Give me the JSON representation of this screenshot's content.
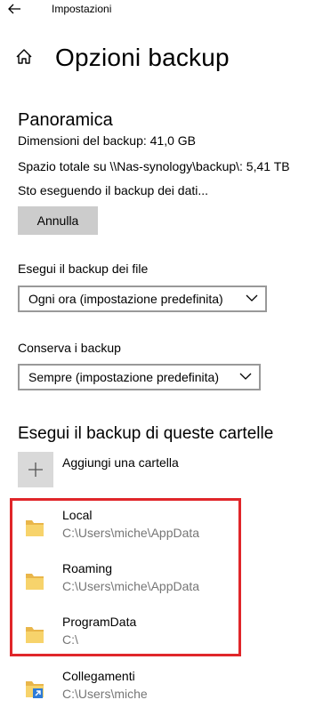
{
  "window": {
    "title": "Impostazioni"
  },
  "header": {
    "page_title": "Opzioni backup"
  },
  "overview": {
    "heading": "Panoramica",
    "size_text": "Dimensioni del backup: 41,0 GB",
    "space_text": "Spazio totale su \\\\Nas-synology\\backup\\: 5,41 TB",
    "status_text": "Sto eseguendo il backup dei dati...",
    "cancel_label": "Annulla"
  },
  "frequency": {
    "label": "Esegui il backup dei file",
    "selected": "Ogni ora (impostazione predefinita)"
  },
  "retention": {
    "label": "Conserva i backup",
    "selected": "Sempre (impostazione predefinita)"
  },
  "folders": {
    "heading": "Esegui il backup di queste cartelle",
    "add_label": "Aggiungi una cartella",
    "items": [
      {
        "name": "Local",
        "path": "C:\\Users\\miche\\AppData"
      },
      {
        "name": "Roaming",
        "path": "C:\\Users\\miche\\AppData"
      },
      {
        "name": "ProgramData",
        "path": "C:\\"
      },
      {
        "name": "Collegamenti",
        "path": "C:\\Users\\miche"
      }
    ]
  },
  "colors": {
    "highlight": "#e0262a",
    "folder": "#f4c85a",
    "button": "#cccccc"
  }
}
